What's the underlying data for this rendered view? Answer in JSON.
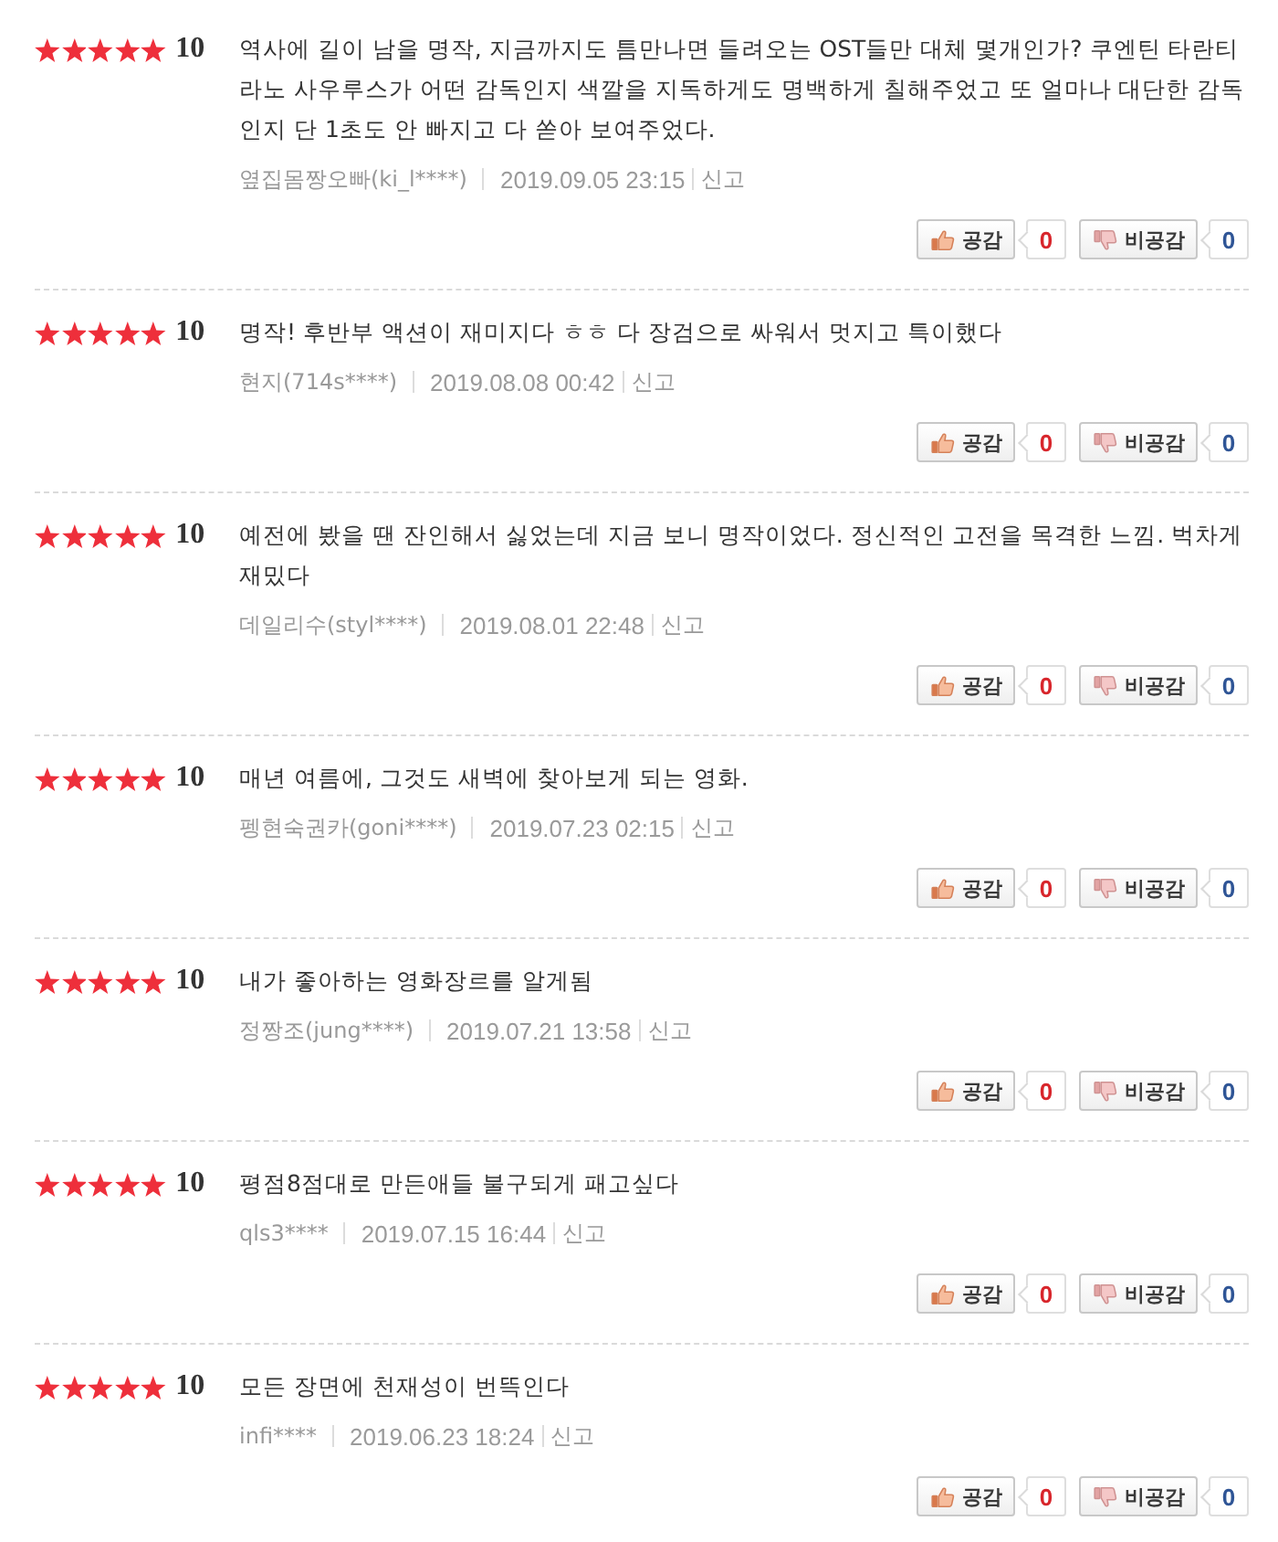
{
  "reviews": [
    {
      "stars": 5,
      "score": "10",
      "text": "역사에 길이 남을 명작, 지금까지도 틈만나면 들려오는 OST들만 대체 몇개인가? 쿠엔틴 타란티라노 사우루스가 어떤 감독인지 색깔을 지독하게도 명백하게 칠해주었고 또 얼마나 대단한 감독인지 단 1초도 안 빠지고 다 쏟아 보여주었다.",
      "author": "옆집몸짱오빠(ki_l****)",
      "date": "2019.09.05 23:15",
      "report": "신고",
      "votes": [
        {
          "kind": "like",
          "label": "공감",
          "count": "0"
        },
        {
          "kind": "dislike",
          "label": "비공감",
          "count": "0"
        }
      ]
    },
    {
      "stars": 5,
      "score": "10",
      "text": "명작! 후반부 액션이 재미지다 ㅎㅎ 다 장검으로 싸워서 멋지고 특이했다",
      "author": "현지(714s****)",
      "date": "2019.08.08 00:42",
      "report": "신고",
      "votes": [
        {
          "kind": "like",
          "label": "공감",
          "count": "0"
        },
        {
          "kind": "dislike",
          "label": "비공감",
          "count": "0"
        }
      ]
    },
    {
      "stars": 5,
      "score": "10",
      "text": "예전에 봤을 땐 잔인해서 싫었는데 지금 보니 명작이었다. 정신적인 고전을 목격한 느낌. 벅차게 재밌다",
      "author": "데일리수(styl****)",
      "date": "2019.08.01 22:48",
      "report": "신고",
      "votes": [
        {
          "kind": "like",
          "label": "공감",
          "count": "0"
        },
        {
          "kind": "dislike",
          "label": "비공감",
          "count": "0"
        }
      ]
    },
    {
      "stars": 5,
      "score": "10",
      "text": "매년 여름에, 그것도 새벽에 찾아보게 되는 영화.",
      "author": "펭현숙권카(goni****)",
      "date": "2019.07.23 02:15",
      "report": "신고",
      "votes": [
        {
          "kind": "like",
          "label": "공감",
          "count": "0"
        },
        {
          "kind": "dislike",
          "label": "비공감",
          "count": "0"
        }
      ]
    },
    {
      "stars": 5,
      "score": "10",
      "text": "내가 좋아하는 영화장르를 알게됨",
      "author": "정짱조(jung****)",
      "date": "2019.07.21 13:58",
      "report": "신고",
      "votes": [
        {
          "kind": "like",
          "label": "공감",
          "count": "0"
        },
        {
          "kind": "dislike",
          "label": "비공감",
          "count": "0"
        }
      ]
    },
    {
      "stars": 5,
      "score": "10",
      "text": "평점8점대로 만든애들 불구되게 패고싶다",
      "author": "qls3****",
      "date": "2019.07.15 16:44",
      "report": "신고",
      "votes": [
        {
          "kind": "like",
          "label": "공감",
          "count": "0"
        },
        {
          "kind": "dislike",
          "label": "비공감",
          "count": "0"
        }
      ]
    },
    {
      "stars": 5,
      "score": "10",
      "text": "모든 장면에 천재성이 번뜩인다",
      "author": "infi****",
      "date": "2019.06.23 18:24",
      "report": "신고",
      "votes": [
        {
          "kind": "like",
          "label": "공감",
          "count": "0"
        },
        {
          "kind": "dislike",
          "label": "비공감",
          "count": "0"
        }
      ]
    }
  ]
}
